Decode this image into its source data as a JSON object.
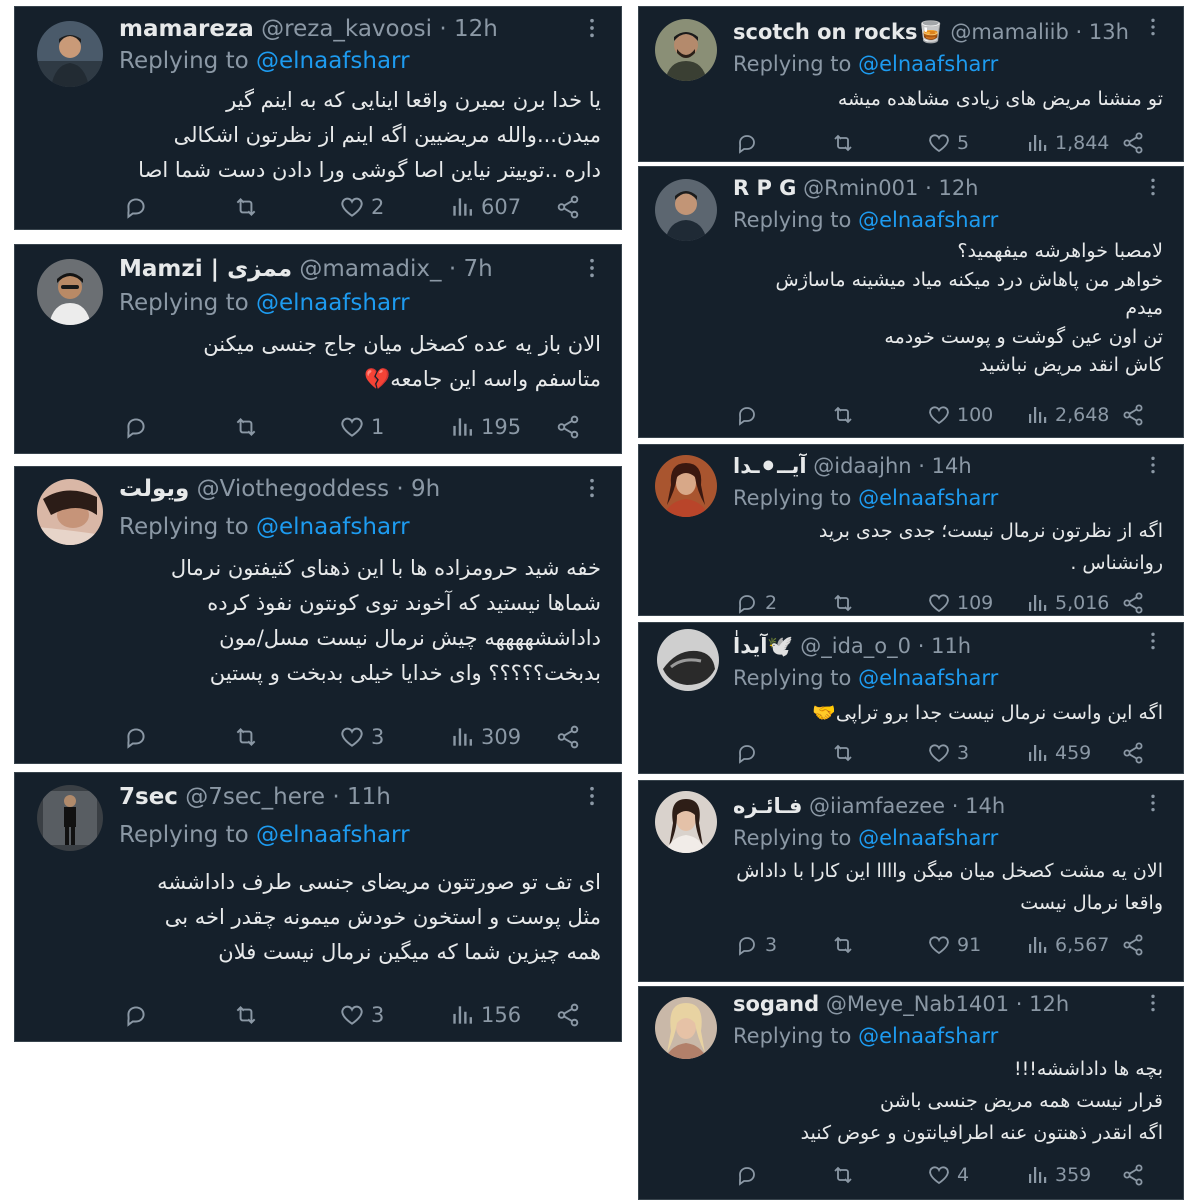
{
  "colors": {
    "card_bg": "#15202b",
    "text": "#e7e9ea",
    "muted": "#8b98a5",
    "link": "#1d9bf0",
    "border": "#38444d"
  },
  "replies": [
    {
      "name": "mamareza",
      "handle": "@reza_kavoosi",
      "time": "12h",
      "replying_prefix": "Replying to",
      "replying_to": "@elnaafsharr",
      "lines": [
        "یا خدا برن بمیرن واقعا اینایی که به اینم گیر",
        "میدن...والله مریضیین اگه اینم از نظرتون اشکالی",
        "داره ..توییتر نیاین اصا گوشی ورا دادن دست شما اصا"
      ],
      "reply_count": "",
      "retweet_count": "",
      "like_count": "2",
      "view_count": "607"
    },
    {
      "name": "Mamzi | ممزی",
      "handle": "@mamadix_",
      "time": "7h",
      "replying_prefix": "Replying to",
      "replying_to": "@elnaafsharr",
      "lines": [
        "الان باز یه عده کصخل میان جاج جنسی میکنن",
        "متاسفم واسه این جامعه💔"
      ],
      "reply_count": "",
      "retweet_count": "",
      "like_count": "1",
      "view_count": "195"
    },
    {
      "name": "ویولت",
      "handle": "@Viothegoddess",
      "time": "9h",
      "replying_prefix": "Replying to",
      "replying_to": "@elnaafsharr",
      "lines": [
        "خفه شید حرومزاده ها با این ذهنای کثیفتون نرمال",
        "شماها نیستید که آخوند توی کونتون نفوذ کرده",
        "داداششههههه چیش نرمال نیست مسل/مون",
        "بدبخت؟؟؟؟؟  وای خدایا خیلی بدبخت و پستین"
      ],
      "reply_count": "",
      "retweet_count": "",
      "like_count": "3",
      "view_count": "309"
    },
    {
      "name": "7sec",
      "handle": "@7sec_here",
      "time": "11h",
      "replying_prefix": "Replying to",
      "replying_to": "@elnaafsharr",
      "lines": [
        "ای تف تو صورتتون مریضای جنسی طرف داداششه",
        "مثل پوست و استخون خودش میمونه چقدر اخه بی",
        "همه چیزین شما که میگین نرمال نیست فلان"
      ],
      "reply_count": "",
      "retweet_count": "",
      "like_count": "3",
      "view_count": "156"
    },
    {
      "name": "scotch on rocks🥃",
      "handle": "@mamaliib",
      "time": "13h",
      "replying_prefix": "Replying to",
      "replying_to": "@elnaafsharr",
      "lines": [
        "تو منشنا مریض های زیادی مشاهده میشه"
      ],
      "reply_count": "",
      "retweet_count": "",
      "like_count": "5",
      "view_count": "1,844"
    },
    {
      "name": "R P G",
      "handle": "@Rmin001",
      "time": "12h",
      "replying_prefix": "Replying to",
      "replying_to": "@elnaafsharr",
      "lines": [
        "لامصبا خواهرشه میفهمید؟",
        "خواهر من پاهاش درد میکنه میاد میشینه ماساژش",
        "میدم",
        "تن اون عین گوشت و پوست خودمه",
        "کاش انقد مریض نباشید"
      ],
      "reply_count": "",
      "retweet_count": "",
      "like_count": "100",
      "view_count": "2,648"
    },
    {
      "name": "آیــ⚫ـدا",
      "handle": "@idaajhn",
      "time": "14h",
      "replying_prefix": "Replying to",
      "replying_to": "@elnaafsharr",
      "lines": [
        "اگه از نظرتون نرمال نیست؛ جدی جدی برید",
        "روانشناس ."
      ],
      "reply_count": "2",
      "retweet_count": "",
      "like_count": "109",
      "view_count": "5,016"
    },
    {
      "name": "آیداٰ🕊️",
      "handle": "@_ida_o_0",
      "time": "11h",
      "replying_prefix": "Replying to",
      "replying_to": "@elnaafsharr",
      "lines": [
        "اگه این واست نرمال نیست جدا برو تراپی🤝"
      ],
      "reply_count": "",
      "retweet_count": "",
      "like_count": "3",
      "view_count": "459"
    },
    {
      "name": "فـائـزه",
      "handle": "@iiamfaezee",
      "time": "14h",
      "replying_prefix": "Replying to",
      "replying_to": "@elnaafsharr",
      "lines": [
        "الان یه مشت کصخل میان میگن واااا این کارا با داداش",
        "واقعا نرمال نیست"
      ],
      "reply_count": "3",
      "retweet_count": "",
      "like_count": "91",
      "view_count": "6,567"
    },
    {
      "name": "sogand",
      "handle": "@Meye_Nab1401",
      "time": "12h",
      "replying_prefix": "Replying to",
      "replying_to": "@elnaafsharr",
      "lines": [
        "بچه ها داداششه!!!",
        "قرار نیست همه مریض جنسی باشن",
        "اگه انقدر ذهنتون عنه اطرافیانتون و عوض کنید"
      ],
      "reply_count": "",
      "retweet_count": "",
      "like_count": "4",
      "view_count": "359"
    }
  ]
}
